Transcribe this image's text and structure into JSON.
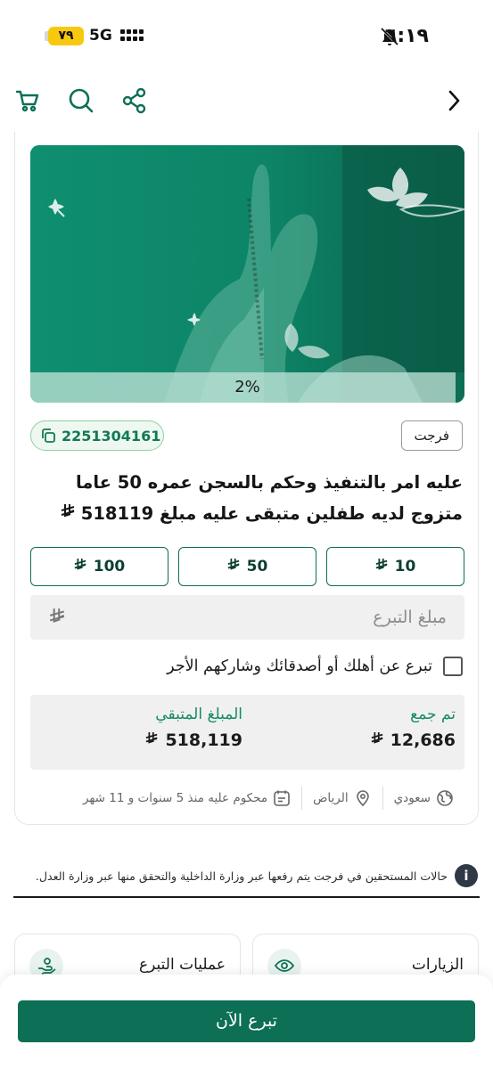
{
  "status_bar": {
    "time": "٦:١٩",
    "battery": "٧٩",
    "network": "5G"
  },
  "top_bar": {
    "icons": [
      "back-chevron-icon",
      "share-icon",
      "search-icon",
      "cart-icon"
    ]
  },
  "case": {
    "progress_label": "2%",
    "progress_fraction": 0.02,
    "tag": "فرجت",
    "case_id": "2251304161",
    "title": "عليه امر بالتنفيذ وحكم بالسجن عمره 50 عاما متزوج لديه طفلين متبقى عليه مبلغ 518119",
    "quick_amounts": [
      "10",
      "50",
      "100"
    ],
    "amount_placeholder": "مبلغ التبرع",
    "gift_label": "تبرع عن أهلك أو أصدقائك وشاركهم الأجر",
    "collected_label": "تم جمع",
    "collected_value": "12,686",
    "remaining_label": "المبلغ المتبقي",
    "remaining_value": "518,119",
    "nationality": "سعودي",
    "city": "الرياض",
    "sentence": "محكوم عليه منذ 5 سنوات و 11 شهر"
  },
  "notice": "حالات المستحقين في فرجت يتم رفعها عبر وزارة الداخلية والتحقق منها عبر وزارة العدل.",
  "cards": {
    "visits": "الزيارات",
    "donations": "عمليات التبرع"
  },
  "footer": {
    "donate_button": "تبرع الآن"
  },
  "colors": {
    "brand_green": "#0d6f55",
    "hero_green": "#0e8a6c",
    "accent_green": "#138a62",
    "battery_yellow": "#f7c90e"
  }
}
